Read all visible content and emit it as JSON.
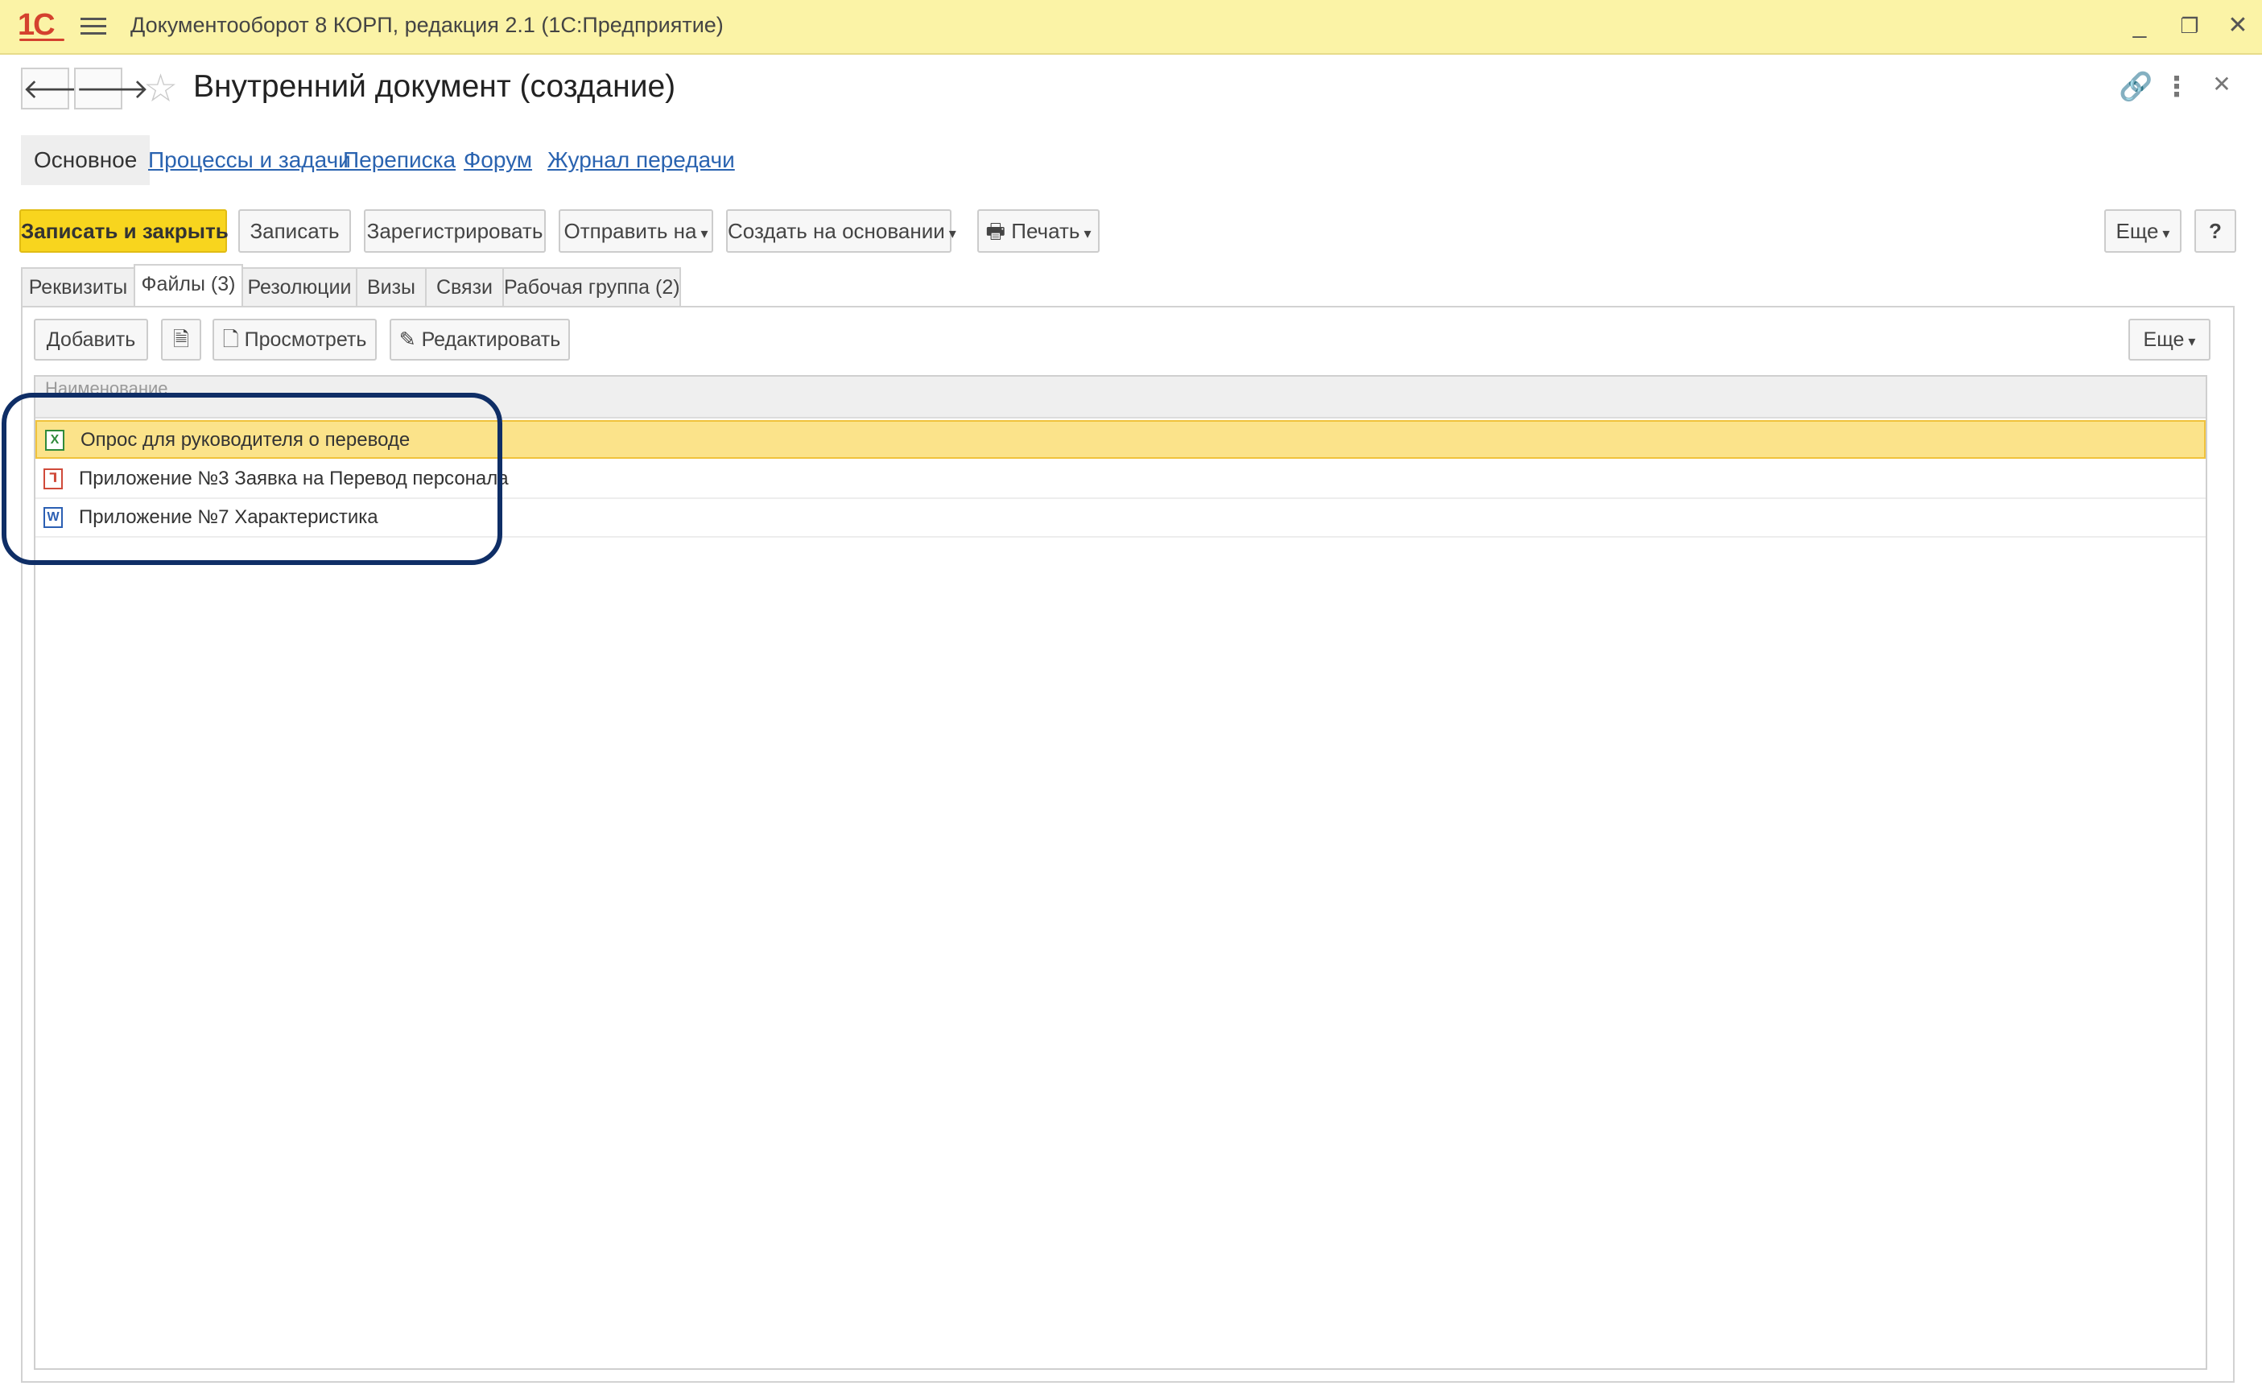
{
  "app": {
    "logo": "1С",
    "title": "Документооборот 8 КОРП, редакция 2.1  (1С:Предприятие)",
    "window_controls": [
      "minimize-icon",
      "restore-icon",
      "close-icon"
    ]
  },
  "header": {
    "back_glyph": "🡐",
    "forward_glyph": "🡒",
    "title": "Внутренний документ (создание)"
  },
  "sections": {
    "active": "Основное",
    "links": [
      "Процессы и задачи",
      "Переписка",
      "Форум",
      "Журнал передачи"
    ]
  },
  "toolbar": {
    "save_close": "Записать и закрыть",
    "save": "Записать",
    "register": "Зарегистрировать",
    "send_to": "Отправить на",
    "create_based": "Создать на основании",
    "print": "Печать",
    "more": "Еще",
    "help": "?"
  },
  "tabs": [
    "Реквизиты",
    "Файлы (3)",
    "Резолюции",
    "Визы",
    "Связи",
    "Рабочая группа (2)"
  ],
  "active_tab_index": 1,
  "files_toolbar": {
    "add": "Добавить",
    "view": "Просмотреть",
    "edit": "Редактировать",
    "more": "Еще"
  },
  "table": {
    "column_header": "Наименование",
    "rows": [
      {
        "icon": "excel-file-icon",
        "glyph": "X",
        "name": "Опрос для руководителя о переводе",
        "selected": true
      },
      {
        "icon": "pdf-file-icon",
        "glyph": "⅂",
        "name": "Приложение №3 Заявка на Перевод персонала",
        "selected": false
      },
      {
        "icon": "word-file-icon",
        "glyph": "W",
        "name": "Приложение №7 Характеристика",
        "selected": false
      }
    ]
  },
  "colors": {
    "titlebar": "#fbf3a6",
    "primary_button": "#f8d51e",
    "selected_row": "#fbe38a",
    "link": "#2a63b0",
    "highlight_frame": "#0f2e66"
  }
}
